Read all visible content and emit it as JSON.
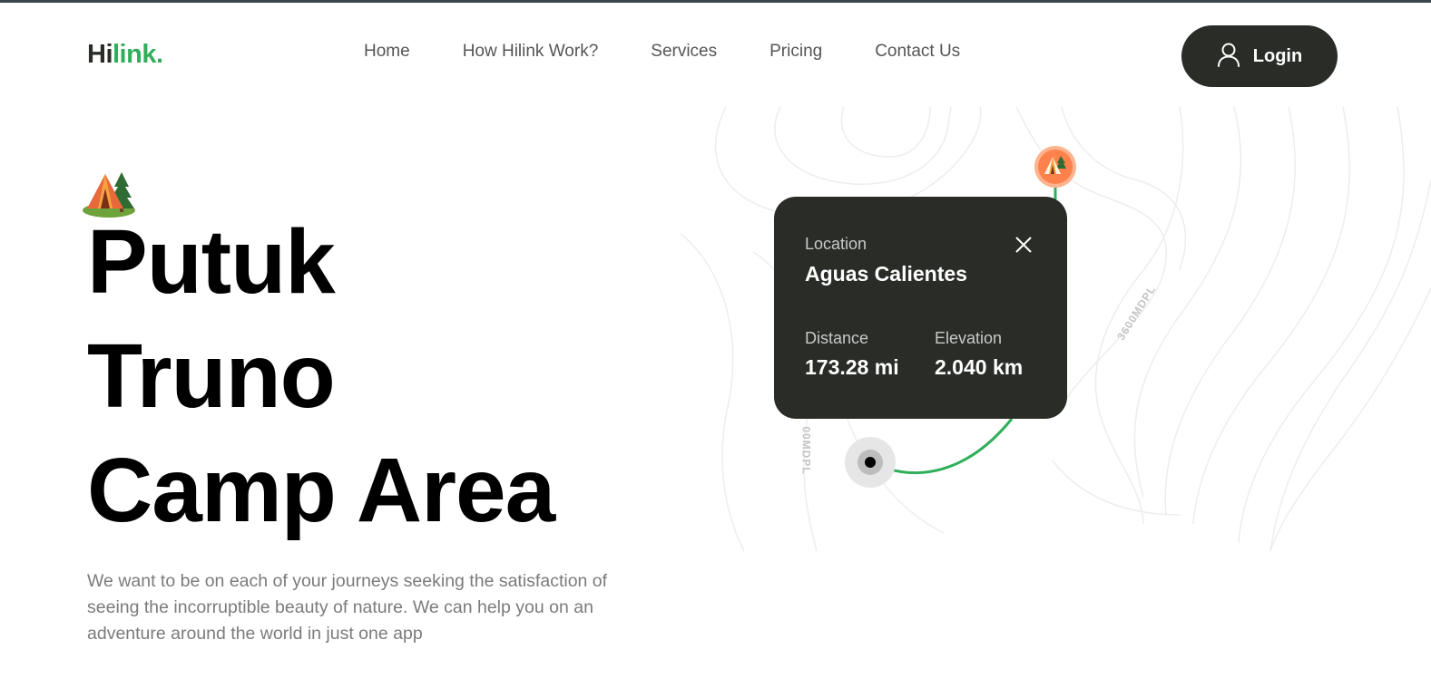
{
  "brand": {
    "logo_part1": "Hi",
    "logo_part2": "link."
  },
  "nav": {
    "items": [
      {
        "label": "Home"
      },
      {
        "label": "How Hilink Work?"
      },
      {
        "label": "Services"
      },
      {
        "label": "Pricing"
      },
      {
        "label": "Contact Us"
      }
    ],
    "login_label": "Login"
  },
  "hero": {
    "title_lines": [
      "Putuk",
      "Truno",
      "Camp Area"
    ],
    "description": "We want to be on each of your journeys seeking the satisfaction of seeing the incorruptible beauty of nature. We can help you on an adventure around the world in just one app"
  },
  "map_card": {
    "location_label": "Location",
    "location_value": "Aguas Calientes",
    "distance_label": "Distance",
    "distance_value": "173.28 mi",
    "elevation_label": "Elevation",
    "elevation_value": "2.040 km"
  },
  "map_labels": {
    "contour_1": "3600MDPL",
    "contour_2": "00MDPL"
  },
  "colors": {
    "dark": "#292C27",
    "green": "#30AF5B",
    "orange_pin": "#FF814C",
    "gray_text": "#7B7B7B"
  },
  "icons": {
    "login": "user-icon",
    "close": "close-icon",
    "camp": "camp-tent-icon",
    "pin": "camp-pin-icon",
    "start": "start-point-icon"
  }
}
